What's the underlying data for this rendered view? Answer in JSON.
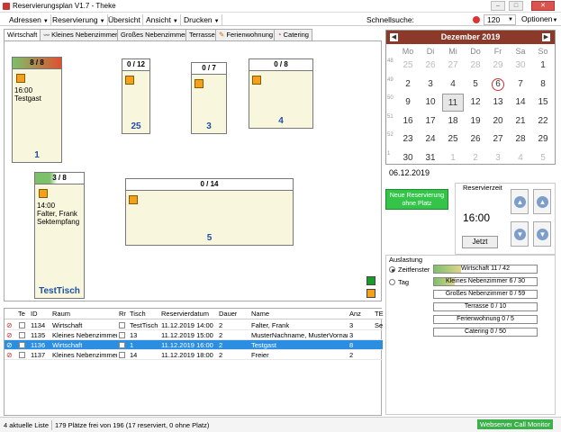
{
  "window": {
    "title": "Reservierungsplan V1.7 - Theke"
  },
  "menu": {
    "items": [
      "Adressen",
      "Reservierung",
      "Übersicht",
      "Ansicht",
      "Drucken"
    ],
    "search_label": "Schnellsuche:",
    "search_value": "120",
    "options": "Optionen"
  },
  "tabs": [
    "Wirtschaft",
    "Kleines Nebenzimmer",
    "Großes Nebenzimmer",
    "Terrasse",
    "Ferienwohnung",
    "Catering"
  ],
  "floor": {
    "tables": [
      {
        "occupancy": "8 / 8",
        "number": "1",
        "time": "16:00",
        "guest": "Testgast",
        "extra": "",
        "fill": 1.0
      },
      {
        "occupancy": "0 / 12",
        "number": "25",
        "time": "",
        "guest": "",
        "extra": "",
        "fill": 0
      },
      {
        "occupancy": "0 / 7",
        "number": "3",
        "time": "",
        "guest": "",
        "extra": "",
        "fill": 0
      },
      {
        "occupancy": "0 / 8",
        "number": "4",
        "time": "",
        "guest": "",
        "extra": "",
        "fill": 0
      },
      {
        "occupancy": "3 / 8",
        "number": "TestTisch",
        "time": "14:00",
        "guest": "Falter, Frank",
        "extra": "Sektempfang",
        "fill": 0.375
      },
      {
        "occupancy": "0 / 14",
        "number": "5",
        "time": "",
        "guest": "",
        "extra": "",
        "fill": 0
      }
    ]
  },
  "list": {
    "headers": [
      "Te",
      "ID",
      "Raum",
      "Rr",
      "Tisch",
      "Reservierdatum",
      "Dauer",
      "Name",
      "Anz",
      "TE"
    ],
    "rows": [
      {
        "id": "1134",
        "room": "Wirtschaft",
        "table": "TestTisch",
        "date": "11.12.2019 14:00",
        "duration": "2",
        "name": "Falter, Frank",
        "count": "3",
        "te": "Se"
      },
      {
        "id": "1135",
        "room": "Kleines Nebenzimmer",
        "table": "13",
        "date": "11.12.2019 15:00",
        "duration": "2",
        "name": "MusterNachname, MusterVornam",
        "count": "3",
        "te": ""
      },
      {
        "id": "1136",
        "room": "Wirtschaft",
        "table": "1",
        "date": "11.12.2019 16:00",
        "duration": "2",
        "name": "Testgast",
        "count": "8",
        "te": ""
      },
      {
        "id": "1137",
        "room": "Kleines Nebenzimmer",
        "table": "14",
        "date": "11.12.2019 18:00",
        "duration": "2",
        "name": "Freier",
        "count": "2",
        "te": ""
      }
    ]
  },
  "calendar": {
    "month": "Dezember 2019",
    "dow": [
      "Mo",
      "Di",
      "Mi",
      "Do",
      "Fr",
      "Sa",
      "So"
    ],
    "weeks": [
      "48",
      "49",
      "50",
      "51",
      "52",
      "1"
    ],
    "days": [
      [
        "25",
        "26",
        "27",
        "28",
        "29",
        "30",
        "1"
      ],
      [
        "2",
        "3",
        "4",
        "5",
        "6",
        "7",
        "8"
      ],
      [
        "9",
        "10",
        "11",
        "12",
        "13",
        "14",
        "15"
      ],
      [
        "16",
        "17",
        "18",
        "19",
        "20",
        "21",
        "22"
      ],
      [
        "23",
        "24",
        "25",
        "26",
        "27",
        "28",
        "29"
      ],
      [
        "30",
        "31",
        "1",
        "2",
        "3",
        "4",
        "5"
      ]
    ],
    "selected_date": "06.12.2019"
  },
  "reservation": {
    "new_button": "Neue Reservierung ohne Platz",
    "label": "Reservierzeit",
    "time": "16:00",
    "now_button": "Jetzt"
  },
  "auslastung": {
    "title": "Auslastung",
    "radio_zeitfenster": "Zeitfenster",
    "radio_tag": "Tag",
    "bars": [
      {
        "label": "Wirtschaft 11 / 42",
        "fill": 0.26
      },
      {
        "label": "Kleines Nebenzimmer 6 / 30",
        "fill": 0.2
      },
      {
        "label": "Großes Nebenzimmer 0 / 59",
        "fill": 0
      },
      {
        "label": "Terrasse 0 / 10",
        "fill": 0
      },
      {
        "label": "Ferienwohnung 0 / 5",
        "fill": 0
      },
      {
        "label": "Catering 0 / 50",
        "fill": 0
      }
    ]
  },
  "status": {
    "list_info": "4 aktuelle Liste",
    "seats_info": "179 Plätze frei von 196 (17 reserviert, 0 ohne Platz)",
    "webserver": "Webserver",
    "callmonitor": "Call Monitor"
  },
  "colors": {
    "accent": "#8b3a2a",
    "selection": "#2b8ee0",
    "green": "#35c44a",
    "table_bg": "#f8f6dc",
    "number": "#1f4fa8"
  }
}
